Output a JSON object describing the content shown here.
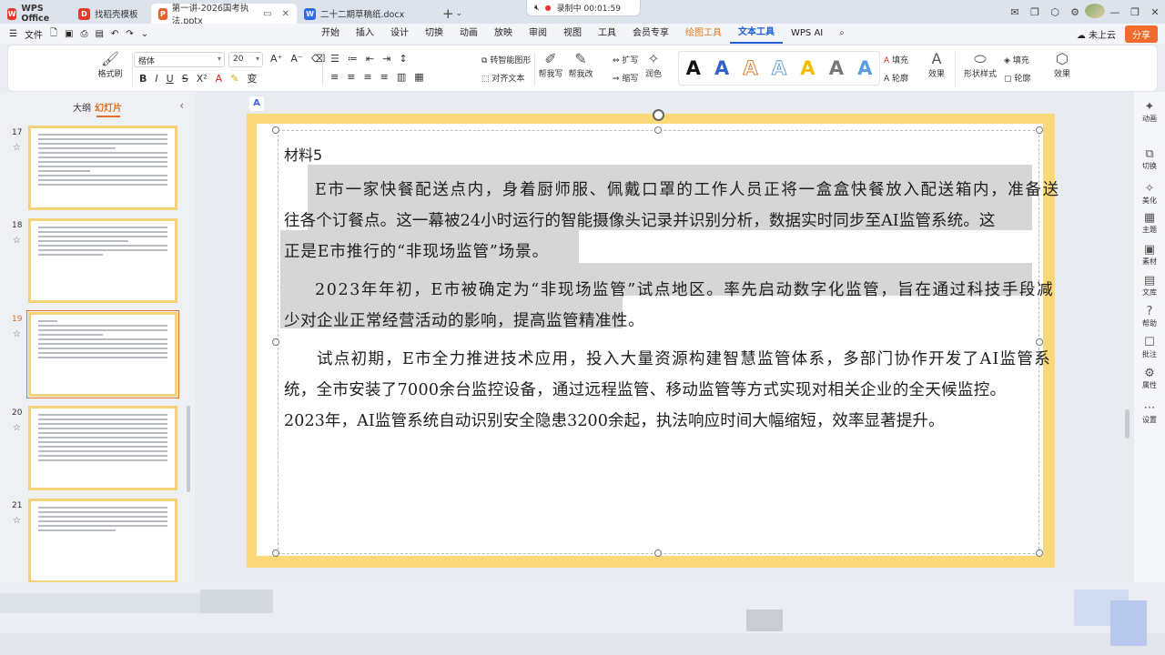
{
  "titlebar": {
    "tabs": [
      {
        "label": "WPS Office",
        "icon": "wps-logo-icon"
      },
      {
        "label": "找稻壳模板",
        "icon": "docer-icon"
      },
      {
        "label": "第一讲-2026国考执法.pptx",
        "icon": "pptx-icon"
      },
      {
        "label": "二十二期草稿纸.docx",
        "icon": "docx-icon"
      }
    ],
    "recording": "录制中 00:01:59"
  },
  "menubar": {
    "file": "文件",
    "menus": [
      "开始",
      "插入",
      "设计",
      "切换",
      "动画",
      "放映",
      "审阅",
      "视图",
      "工具",
      "会员专享",
      "绘图工具",
      "文本工具",
      "WPS AI"
    ],
    "cloud": "未上云",
    "share": "分享"
  },
  "ribbon": {
    "format_painter": "格式刷",
    "font_name": "楷体",
    "font_size": "20",
    "smart_shape": "转智能图形",
    "align_text": "对齐文本",
    "rewrite": "帮我写",
    "revise": "帮我改",
    "expand": "扩写",
    "shorten": "缩写",
    "polish": "润色",
    "wordart_letter": "A",
    "fill": "填充",
    "outline": "轮廓",
    "effect": "效果",
    "shape_style": "形状样式",
    "fill2": "填充",
    "outline2": "轮廓",
    "effect2": "效果"
  },
  "leftpanel": {
    "tab_outline": "大纲",
    "tab_slides": "幻灯片",
    "slides": [
      {
        "num": "17"
      },
      {
        "num": "18"
      },
      {
        "num": "19"
      },
      {
        "num": "20"
      },
      {
        "num": "21"
      }
    ]
  },
  "slide": {
    "heading": "材料5",
    "lines": [
      "E市一家快餐配送点内，身着厨师服、佩戴口罩的工作人员正将一盒盒快餐放入配送箱内，准备送",
      "往各个订餐点。这一幕被24小时运行的智能摄像头记录并识别分析，数据实时同步至AI监管系统。这",
      "正是E市推行的“非现场监管”场景。",
      "2023年年初，E市被确定为“非现场监管”试点地区。率先启动数字化监管，旨在通过科技手段减",
      "少对企业正常经营活动的影响，提高监管精准性。",
      "试点初期，E市全力推进技术应用，投入大量资源构建智慧监管体系，多部门协作开发了AI监管系",
      "统，全市安装了7000余台监控设备，通过远程监管、移动监管等方式实现对相关企业的全天候监控。",
      "2023年，AI监管系统自动识别安全隐患3200余起，执法响应时间大幅缩短，效率显著提升。"
    ]
  },
  "rightrail": [
    "动画",
    "切换",
    "美化",
    "主题",
    "素材",
    "文库",
    "帮助",
    "批注",
    "属性",
    "设置"
  ]
}
